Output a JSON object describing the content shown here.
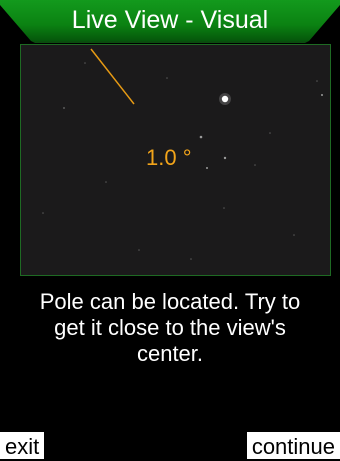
{
  "header": {
    "title": "Live View - Visual",
    "accent_color": "#0b8a12"
  },
  "live_view": {
    "angle_label": "1.0 °",
    "indicator_color": "#f2a41a"
  },
  "message": {
    "lines": [
      "Pole can be located. Try to",
      "get it close to the view's",
      "center."
    ]
  },
  "softkeys": {
    "left": "exit",
    "right": "continue"
  }
}
